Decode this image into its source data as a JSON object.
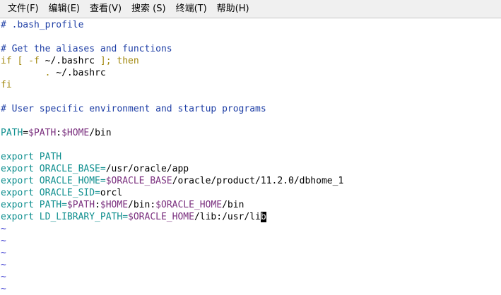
{
  "menu": [
    "文件(F)",
    "编辑(E)",
    "查看(V)",
    "搜索 (S)",
    "终端(T)",
    "帮助(H)"
  ],
  "editor": {
    "l1": "# .bash_profile",
    "l2": "",
    "l3": "# Get the aliases and functions",
    "l4_kw1": "if [ -f ",
    "l4_path": "~/.bashrc",
    "l4_kw2": " ]; then",
    "l5_dot": "        . ",
    "l5_path": "~/.bashrc",
    "l6": "fi",
    "l7": "",
    "l8": "# User specific environment and startup programs",
    "l9": "",
    "l10_name": "PATH",
    "l10_eq": "=",
    "l10_v1": "$PATH",
    "l10_c": ":",
    "l10_v2": "$HOME",
    "l10_rest": "/bin",
    "l11": "",
    "l12_cmd": "export PATH",
    "l13_cmd": "export ORACLE_BASE",
    "l13_eq": "=",
    "l13_rest": "/usr/oracle/app",
    "l14_cmd": "export ORACLE_HOME",
    "l14_eq": "=",
    "l14_v1": "$ORACLE_BASE",
    "l14_rest": "/oracle/product/11.2.0/dbhome_1",
    "l15_cmd": "export ORACLE_SID",
    "l15_eq": "=",
    "l15_rest": "orcl",
    "l16_cmd": "export PATH",
    "l16_eq": "=",
    "l16_v1": "$PATH",
    "l16_c1": ":",
    "l16_v2": "$HOME",
    "l16_mid": "/bin:",
    "l16_v3": "$ORACLE_HOME",
    "l16_rest": "/bin",
    "l17_cmd": "export LD_LIBRARY_PATH",
    "l17_eq": "=",
    "l17_v1": "$ORACLE_HOME",
    "l17_rest": "/lib:/usr/li",
    "l17_cursor": "b",
    "tilde": "~"
  }
}
